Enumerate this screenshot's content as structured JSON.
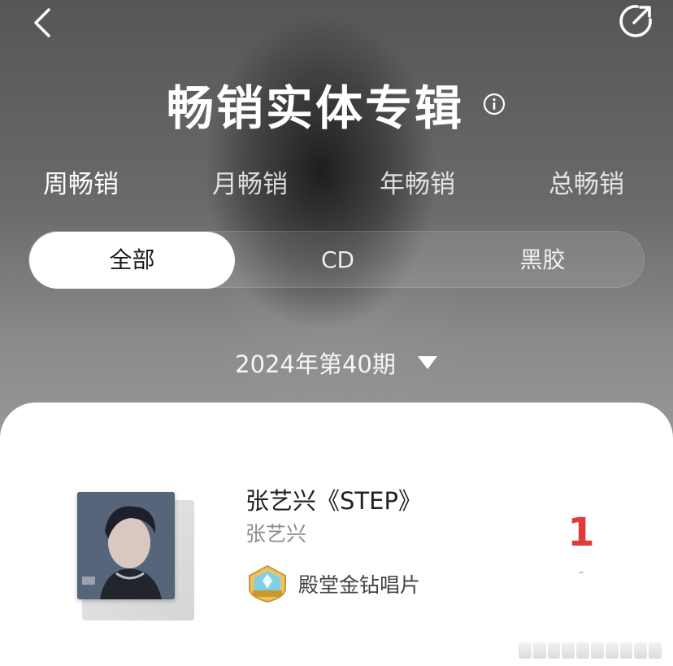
{
  "header": {
    "title": "畅销实体专辑"
  },
  "period_tabs": [
    {
      "label": "周畅销",
      "active": true
    },
    {
      "label": "月畅销",
      "active": false
    },
    {
      "label": "年畅销",
      "active": false
    },
    {
      "label": "总畅销",
      "active": false
    }
  ],
  "format_filter": [
    {
      "label": "全部",
      "active": true
    },
    {
      "label": "CD",
      "active": false
    },
    {
      "label": "黑胶",
      "active": false
    }
  ],
  "issue_selector": {
    "label": "2024年第40期"
  },
  "albums": [
    {
      "title": "张艺兴《STEP》",
      "artist": "张艺兴",
      "badge": "殿堂金钻唱片",
      "rank": "1",
      "rank_change": "-"
    }
  ],
  "colors": {
    "accent_rank": "#e03a3a",
    "card_bg": "#ffffff",
    "text_primary": "#222222",
    "text_secondary": "#8d8d8d"
  },
  "icons": {
    "back": "chevron-left-icon",
    "share": "share-icon",
    "info": "info-icon",
    "issue_dropdown": "caret-down-icon",
    "badge": "diamond-record-badge-icon"
  }
}
